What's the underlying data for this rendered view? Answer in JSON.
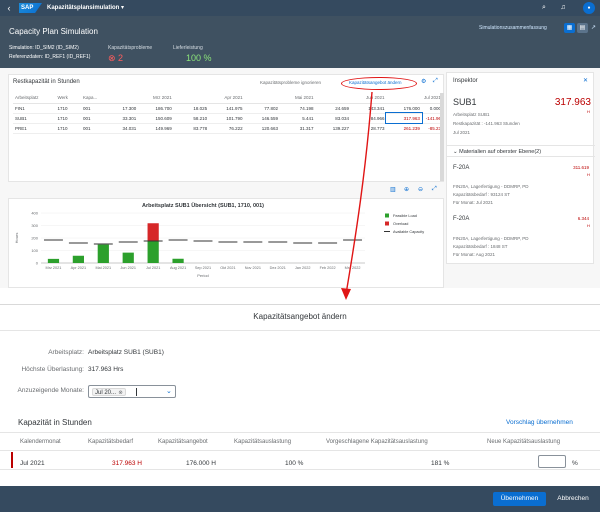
{
  "shell": {
    "logo": "SAP",
    "app_title": "Kapazitätsplansimulation ▾",
    "icons": [
      "back-icon",
      "search-icon",
      "bell-icon",
      "avatar"
    ],
    "avatar_initials": ""
  },
  "header": {
    "title": "Capacity Plan Simulation",
    "summary_link": "Simulationszusammenfassung",
    "simulation": "Simulation: ID_SIM2 (ID_SIM2)",
    "reference": "Referenzdaten: ID_REF1 (ID_REF1)",
    "kpi_problems_label": "Kapazitätsprobleme",
    "kpi_problems_value": "2",
    "kpi_delivery_label": "Lieferleistung",
    "kpi_delivery_value": "100 %"
  },
  "table": {
    "title": "Restkapazität in Stunden",
    "sim_link": "Kapazitätsprobleme ignorieren",
    "change_link": "Kapazitätsangebot ändern",
    "columns": [
      "Arbeitsplatz",
      "Werk",
      "Kapa..."
    ],
    "month_headers": [
      "",
      "Mrz 2021",
      "",
      "Apr 2021",
      "",
      "Mai 2021",
      "",
      "Jun 2021",
      "",
      "Jul 2021"
    ],
    "rows": [
      {
        "ap": "FIN1",
        "werk": "1710",
        "kapa": "001",
        "v": [
          "17.300",
          "186.700",
          "18.025",
          "141.975",
          "77.802",
          "74.198",
          "24.659",
          "143.341",
          "176.000",
          "0.000"
        ]
      },
      {
        "ap": "SUB1",
        "werk": "1710",
        "kapa": "001",
        "v": [
          "33.301",
          "150.609",
          "58.210",
          "101.790",
          "146.559",
          "5.441",
          "83.034",
          "84.966",
          "317.963",
          "-141.96"
        ]
      },
      {
        "ap": "PRE1",
        "werk": "1710",
        "kapa": "001",
        "v": [
          "34.031",
          "149.969",
          "83.778",
          "76.222",
          "120.663",
          "31.317",
          "139.227",
          "28.773",
          "261.239",
          "-85.23"
        ]
      }
    ]
  },
  "chart_data": {
    "type": "bar",
    "title": "Arbeitsplatz SUB1 Übersicht (SUB1, 1710, 001)",
    "xlabel": "Period",
    "ylabel": "Hours",
    "ylim": [
      0,
      400
    ],
    "yticks": [
      "400",
      "300",
      "200",
      "100",
      "0"
    ],
    "categories": [
      "Mrz 2021",
      "Apr 2021",
      "Mai 2021",
      "Jun 2021",
      "Jul 2021",
      "Aug 2021",
      "Sep 2021",
      "Okt 2021",
      "Nov 2021",
      "Dez 2021",
      "Jan 2022",
      "Feb 2022",
      "Mrz 2022"
    ],
    "series": [
      {
        "name": "Feasible Load",
        "color": "#2ca02c",
        "values": [
          33,
          58,
          147,
          83,
          176,
          34,
          0,
          0,
          0,
          0,
          0,
          0,
          0
        ]
      },
      {
        "name": "Overload",
        "color": "#d62728",
        "values": [
          0,
          0,
          0,
          0,
          142,
          0,
          0,
          0,
          0,
          0,
          0,
          0,
          0
        ]
      },
      {
        "name": "Available Capacity",
        "color": "#333333",
        "values": [
          184,
          160,
          152,
          168,
          176,
          184,
          176,
          168,
          168,
          168,
          160,
          160,
          184
        ]
      }
    ],
    "legend": "right"
  },
  "inspector": {
    "title": "Inspektor",
    "name": "SUB1",
    "value": "317.963",
    "unit": "H",
    "workcenter": "Arbeitsplatz SUB1",
    "rest": "Restkapazität : -141.963 Stunden",
    "month": "Jul 2021",
    "section": "Materialien auf oberster Ebene(2)",
    "materials": [
      {
        "name": "F-20A",
        "value": "311.619",
        "unit": "H",
        "line1": "FIN20A, Lagerfertigung - DDMRP, PD",
        "line2": "Kapazitätsbedarf : 93124 ST",
        "line3": "Für Monat: Jul 2021"
      },
      {
        "name": "F-20A",
        "value": "6.344",
        "unit": "H",
        "line1": "FIN20A, Lagerfertigung - DDMRP, PD",
        "line2": "Kapazitätsbedarf : 1848 ST",
        "line3": "Für Monat: Aug 2021"
      }
    ]
  },
  "dialog": {
    "title": "Kapazitätsangebot ändern",
    "workplace_label": "Arbeitsplatz:",
    "workplace_value": "Arbeitsplatz SUB1 (SUB1)",
    "overload_label": "Höchste Überlastung:",
    "overload_value": "317.963 Hrs",
    "months_label": "Anzuzeigende Monate:",
    "months_token": "Jul 20...",
    "section_title": "Kapazität in Stunden",
    "proposal_link": "Vorschlag übernehmen",
    "columns": [
      "Kalendermonat",
      "Kapazitätsbedarf",
      "Kapazitätsangebot",
      "Kapazitätsauslastung",
      "Vorgeschlagene Kapazitätsauslastung",
      "Neue Kapazitätsauslastung"
    ],
    "row": {
      "month": "Jul 2021",
      "demand": "317.963 H",
      "supply": "176.000 H",
      "utilization": "100 %",
      "proposed": "181 %",
      "new_value": "",
      "new_unit": "%"
    },
    "accept_button": "Übernehmen",
    "cancel_button": "Abbrechen"
  },
  "colors": {
    "shell": "#354a5f",
    "accent": "#0a6ed1",
    "negative": "#bb0000",
    "annotation": "#e01515"
  }
}
